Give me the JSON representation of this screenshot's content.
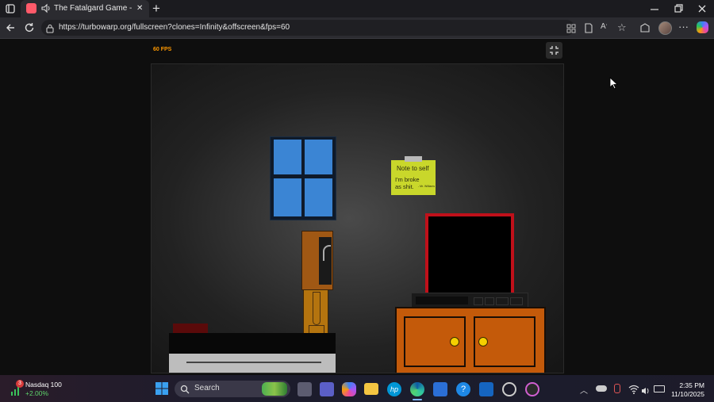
{
  "browser": {
    "tab_title": "The Fatalgard Game - Turbo",
    "url": "https://turbowarp.org/fullscreen?clones=Infinity&offscreen&fps=60",
    "new_tab_glyph": "+",
    "close_tab_glyph": "✕",
    "icons": [
      "tab-actions-icon",
      "audio-icon",
      "back-icon",
      "refresh-icon",
      "site-info-icon",
      "app-available-icon",
      "reading-view-icon",
      "read-aloud-icon",
      "favorite-icon",
      "collections-icon",
      "profile-avatar",
      "more-icon",
      "copilot-icon",
      "minimize-icon",
      "restore-icon",
      "close-icon"
    ]
  },
  "game": {
    "fps_label": "60 FPS",
    "note_title": "Note to self",
    "note_body": "I'm broke as shit.",
    "note_signature": "- Mr. Williams",
    "colors": {
      "fps": "#ff9900",
      "note": "#c8d62a",
      "window": "#3d87d6",
      "tv_frame": "#c0101a",
      "cabinet": "#c45a0a",
      "knob": "#f5d000"
    }
  },
  "taskbar": {
    "ticker_name": "Nasdaq 100",
    "ticker_change": "+2.00%",
    "ticker_badge": "3",
    "search_label": "Search",
    "time": "2:35 PM",
    "date": "11/10/2025"
  }
}
